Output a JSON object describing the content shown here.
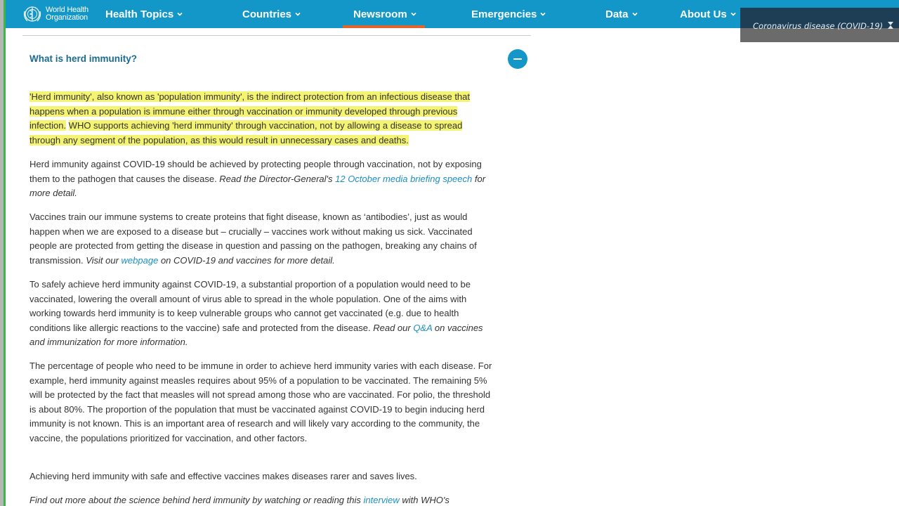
{
  "navbar": {
    "logo": {
      "line1": "World Health",
      "line2": "Organization"
    },
    "items": [
      {
        "label": "Health Topics",
        "active": false
      },
      {
        "label": "Countries",
        "active": false
      },
      {
        "label": "Newsroom",
        "active": true
      },
      {
        "label": "Emergencies",
        "active": false
      },
      {
        "label": "Data",
        "active": false
      },
      {
        "label": "About Us",
        "active": false
      }
    ],
    "active_color": "#e0642b",
    "bg_color": "#1397c8"
  },
  "covid_banner": {
    "text": "Coronavirus disease (COVID-19)",
    "icon": "pin-icon"
  },
  "accordion": {
    "title": "What is herd immunity?",
    "state": "expanded",
    "toggle_icon": "minus-icon"
  },
  "article": {
    "p1": {
      "hl1": "'Herd immunity', also known as 'population immunity', is the indirect protection from an infectious disease that happens when a population is immune either through vaccination or immunity developed through previous infection.",
      "hl2": "WHO supports achieving 'herd immunity' through vaccination, not by allowing a disease to spread through any segment of the population, as this would result in unnecessary cases and deaths."
    },
    "p2": {
      "text": "Herd immunity against COVID-19 should be achieved by protecting people through vaccination, not by exposing them to the pathogen that causes the disease. ",
      "italic_pre": "Read the Director-General's ",
      "link": "12 October media briefing speech",
      "italic_post": " for more detail."
    },
    "p3": {
      "text": "Vaccines train our immune systems to create proteins that fight disease, known as ‘antibodies’, just as would happen when we are exposed to a disease but – crucially – vaccines work without making us sick. Vaccinated people are protected from getting the disease in question and passing on the pathogen, breaking any chains of transmission. ",
      "italic_pre": "Visit our ",
      "link": "webpage",
      "italic_post": " on COVID-19 and vaccines for more detail."
    },
    "p4": {
      "text": "To safely achieve herd immunity against COVID-19, a substantial proportion of a population would need to be vaccinated, lowering the overall amount of virus able to spread in the whole population. One of the aims with working towards herd immunity is to keep vulnerable groups who cannot get vaccinated (e.g. due to health conditions like allergic reactions to the vaccine) safe and protected from the disease. ",
      "italic_pre": "Read our ",
      "link": "Q&A",
      "italic_post": " on vaccines and immunization for more information."
    },
    "p5": {
      "text": "The percentage of people who need to be immune in order to achieve herd immunity varies with each disease. For example, herd immunity against measles requires about 95% of a population to be vaccinated. The remaining 5% will be protected by the fact that measles will not spread among those who are vaccinated. For polio, the threshold is about 80%. The proportion of the population that must be vaccinated against COVID-19 to begin inducing herd immunity is not known. This is an important area of research and will likely vary according to the community, the vaccine, the populations prioritized for vaccination, and other factors."
    },
    "p6": {
      "text": "Achieving herd immunity with safe and effective vaccines makes diseases rarer and saves lives."
    },
    "p7": {
      "italic_pre": "Find out more about the science behind herd immunity by watching or reading this ",
      "link": "interview",
      "italic_post": " with WHO's"
    }
  }
}
